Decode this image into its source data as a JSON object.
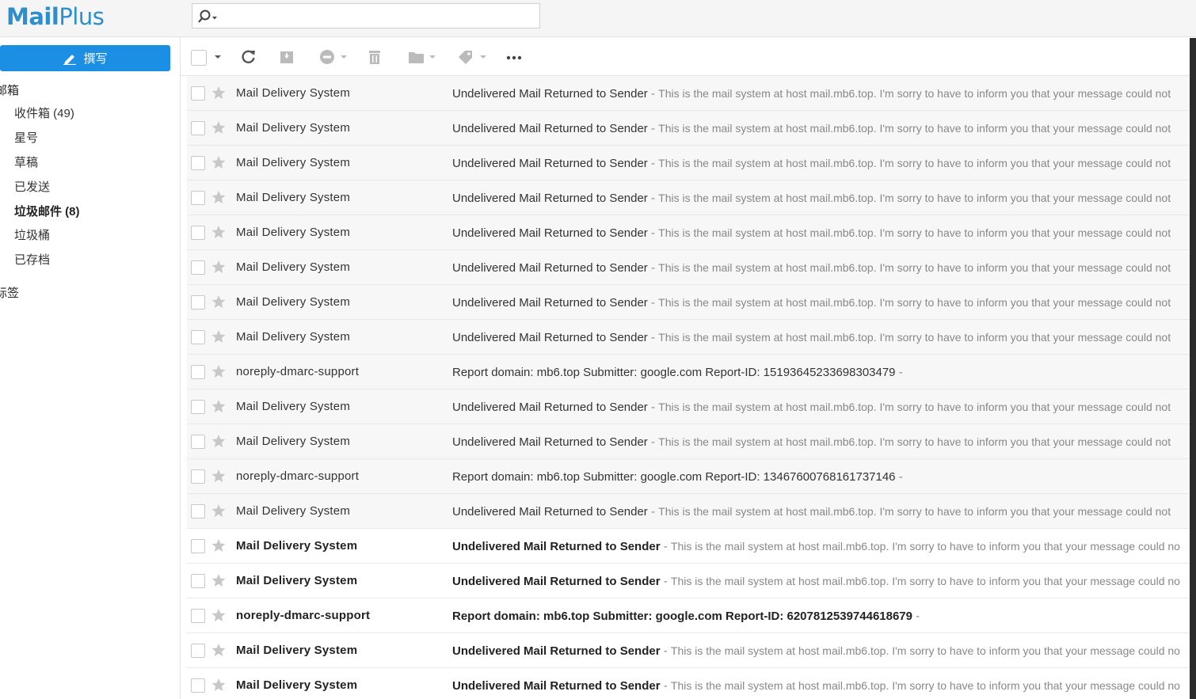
{
  "app": {
    "logo_main": "Mail",
    "logo_sub": "Plus"
  },
  "search": {
    "placeholder": "",
    "value": ""
  },
  "sidebar": {
    "compose_label": "撰写",
    "mailbox_heading": "邮箱",
    "folders": [
      {
        "label": "收件箱 (49)",
        "state": "active"
      },
      {
        "label": "星号",
        "state": "normal"
      },
      {
        "label": "草稿",
        "state": "normal"
      },
      {
        "label": "已发送",
        "state": "normal"
      },
      {
        "label": "垃圾邮件 (8)",
        "state": "bold"
      },
      {
        "label": "垃圾桶",
        "state": "normal"
      },
      {
        "label": "已存档",
        "state": "normal"
      }
    ],
    "labels_heading": "标签"
  },
  "toolbar": {
    "buttons": [
      "select-all",
      "refresh",
      "archive",
      "block",
      "delete",
      "move-to-folder",
      "tag",
      "more"
    ]
  },
  "colors": {
    "accent": "#1a8fe3",
    "active_folder_bg": "#e3eefb",
    "read_row_bg": "#f7f7f7"
  },
  "messages": [
    {
      "sender": "Mail Delivery System",
      "subject": "Undelivered Mail Returned to Sender",
      "separator": " - ",
      "preview": "This is the mail system at host mail.mb6.top. I'm sorry to have to inform you that your message could not",
      "unread": false
    },
    {
      "sender": "Mail Delivery System",
      "subject": "Undelivered Mail Returned to Sender",
      "separator": " - ",
      "preview": "This is the mail system at host mail.mb6.top. I'm sorry to have to inform you that your message could not",
      "unread": false
    },
    {
      "sender": "Mail Delivery System",
      "subject": "Undelivered Mail Returned to Sender",
      "separator": " - ",
      "preview": "This is the mail system at host mail.mb6.top. I'm sorry to have to inform you that your message could not",
      "unread": false
    },
    {
      "sender": "Mail Delivery System",
      "subject": "Undelivered Mail Returned to Sender",
      "separator": " - ",
      "preview": "This is the mail system at host mail.mb6.top. I'm sorry to have to inform you that your message could not",
      "unread": false
    },
    {
      "sender": "Mail Delivery System",
      "subject": "Undelivered Mail Returned to Sender",
      "separator": " - ",
      "preview": "This is the mail system at host mail.mb6.top. I'm sorry to have to inform you that your message could not",
      "unread": false
    },
    {
      "sender": "Mail Delivery System",
      "subject": "Undelivered Mail Returned to Sender",
      "separator": " - ",
      "preview": "This is the mail system at host mail.mb6.top. I'm sorry to have to inform you that your message could not",
      "unread": false
    },
    {
      "sender": "Mail Delivery System",
      "subject": "Undelivered Mail Returned to Sender",
      "separator": " - ",
      "preview": "This is the mail system at host mail.mb6.top. I'm sorry to have to inform you that your message could not",
      "unread": false
    },
    {
      "sender": "Mail Delivery System",
      "subject": "Undelivered Mail Returned to Sender",
      "separator": " - ",
      "preview": "This is the mail system at host mail.mb6.top. I'm sorry to have to inform you that your message could not",
      "unread": false
    },
    {
      "sender": "noreply-dmarc-support",
      "subject": "Report domain: mb6.top Submitter: google.com Report-ID: 15193645233698303479",
      "separator": " -",
      "preview": "",
      "unread": false
    },
    {
      "sender": "Mail Delivery System",
      "subject": "Undelivered Mail Returned to Sender",
      "separator": " - ",
      "preview": "This is the mail system at host mail.mb6.top. I'm sorry to have to inform you that your message could not",
      "unread": false
    },
    {
      "sender": "Mail Delivery System",
      "subject": "Undelivered Mail Returned to Sender",
      "separator": " - ",
      "preview": "This is the mail system at host mail.mb6.top. I'm sorry to have to inform you that your message could not",
      "unread": false
    },
    {
      "sender": "noreply-dmarc-support",
      "subject": "Report domain: mb6.top Submitter: google.com Report-ID: 13467600768161737146",
      "separator": " -",
      "preview": "",
      "unread": false
    },
    {
      "sender": "Mail Delivery System",
      "subject": "Undelivered Mail Returned to Sender",
      "separator": " - ",
      "preview": "This is the mail system at host mail.mb6.top. I'm sorry to have to inform you that your message could not",
      "unread": false
    },
    {
      "sender": "Mail Delivery System",
      "subject": "Undelivered Mail Returned to Sender",
      "separator": " - ",
      "preview": "This is the mail system at host mail.mb6.top. I'm sorry to have to inform you that your message could no",
      "unread": true
    },
    {
      "sender": "Mail Delivery System",
      "subject": "Undelivered Mail Returned to Sender",
      "separator": " - ",
      "preview": "This is the mail system at host mail.mb6.top. I'm sorry to have to inform you that your message could no",
      "unread": true
    },
    {
      "sender": "noreply-dmarc-support",
      "subject": "Report domain: mb6.top Submitter: google.com Report-ID: 6207812539744618679",
      "separator": " -",
      "preview": "",
      "unread": true
    },
    {
      "sender": "Mail Delivery System",
      "subject": "Undelivered Mail Returned to Sender",
      "separator": " - ",
      "preview": "This is the mail system at host mail.mb6.top. I'm sorry to have to inform you that your message could no",
      "unread": true
    },
    {
      "sender": "Mail Delivery System",
      "subject": "Undelivered Mail Returned to Sender",
      "separator": " - ",
      "preview": "This is the mail system at host mail.mb6.top. I'm sorry to have to inform you that your message could no",
      "unread": true
    }
  ]
}
